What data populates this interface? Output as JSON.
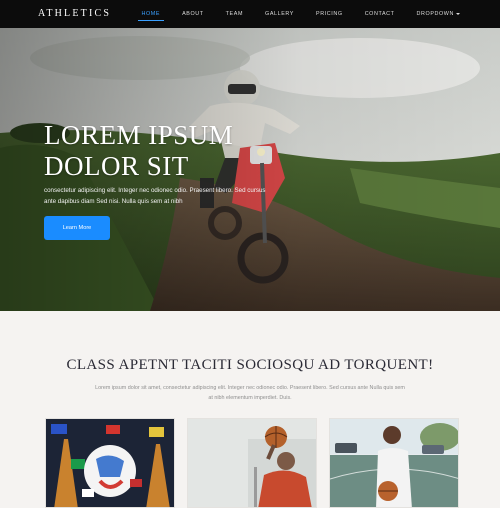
{
  "brand": "ATHLETICS",
  "nav": {
    "items": [
      "HOME",
      "ABOUT",
      "TEAM",
      "GALLERY",
      "PRICING",
      "CONTACT",
      "DROPDOWN"
    ],
    "active": "HOME"
  },
  "hero": {
    "title": "LOREM IPSUM DOLOR SIT",
    "text": "consectetur adipiscing elit. Integer nec odionec odio. Praesent libero. Sed cursus ante dapibus diam Sed nisi. Nulla quis sem at nibh",
    "button": "Learn More"
  },
  "section": {
    "title": "CLASS APETNT TACITI SOCIOSQU AD TORQUENT!",
    "text": "Lorem ipsum dolor sit amet, consectetur adipiscing elit. Integer nec odionec odio. Praesent libero. Sed cursus ante Nulla quis sem at nibh elementum imperdiet. Duis."
  },
  "colors": {
    "accent": "#1a8cff",
    "nav_active": "#3aa0ff",
    "navbar_bg": "#0c0c0c"
  }
}
